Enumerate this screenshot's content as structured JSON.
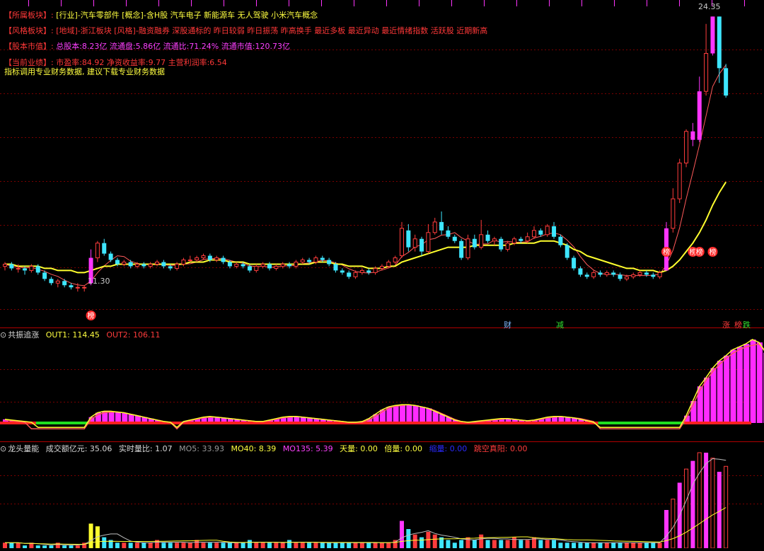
{
  "info": {
    "sector": {
      "key": "【所属板块】:",
      "value": "[行业]-汽车零部件 [概念]-含H股 汽车电子 新能源车 无人驾驶 小米汽车概念"
    },
    "style": {
      "key": "【风格板块】:",
      "value": "[地域]-浙江板块 [风格]-融资融券 深股通标的 昨日较弱 昨日振荡 昨高换手 最近多板 最近异动 最近情绪指数 活跃股 近期新高"
    },
    "capital": {
      "key": "【股本市值】:",
      "value": "总股本:8.23亿 流通盘:5.86亿 流通比:71.24% 流通市值:120.73亿"
    },
    "perf": {
      "key": "【当前业绩】:",
      "value": "市盈率:84.92 净资收益率:9.77 主营利润率:6.54"
    },
    "note": "指标调用专业财务数据, 建议下载专业财务数据"
  },
  "labels": {
    "price_high": "24.35",
    "price_low": "11.30",
    "limit_glyph": "榜",
    "cai": "财",
    "jian": "减",
    "zhang": "涨",
    "die": "跌"
  },
  "indicator1": {
    "name": "共振追涨",
    "out1": "OUT1: 114.45",
    "out2": "OUT2: 106.11"
  },
  "indicator2": {
    "name": "龙头量能",
    "amount": "成交额亿元: 35.06",
    "ratio": "实时量比: 1.07",
    "mo5": "MO5: 33.93",
    "mo40": "MO40: 8.39",
    "mo135": "MO135: 5.39",
    "tianliang": "天量: 0.00",
    "beiliang": "倍量: 0.00",
    "suoliang": "缩量: 0.00",
    "tiaokong": "跳空真阳: 0.00"
  },
  "colors": {
    "up": "#ff3c3c",
    "down": "#3ee6ff",
    "limit": "#ff35ff",
    "ma_yellow": "#ffff2e",
    "ma_red": "#ff5a5a",
    "grid": "#7a0000",
    "green": "#1fe01f",
    "osc": "#ff2bff"
  },
  "chart_data": [
    {
      "type": "candlestick",
      "title": "",
      "price_high": 24.35,
      "price_low": 11.3,
      "ylim": [
        10.3,
        25.0
      ],
      "candles": [
        [
          12.5,
          12.6,
          12.7,
          12.3
        ],
        [
          12.6,
          12.4,
          12.7,
          12.3
        ],
        [
          12.4,
          12.4,
          12.6,
          12.2
        ],
        [
          12.4,
          12.3,
          12.5,
          12.1
        ],
        [
          12.3,
          12.5,
          12.6,
          12.2
        ],
        [
          12.5,
          12.2,
          12.6,
          12.1
        ],
        [
          12.2,
          11.9,
          12.3,
          11.8
        ],
        [
          11.9,
          11.7,
          12.0,
          11.6
        ],
        [
          11.7,
          11.8,
          11.9,
          11.5
        ],
        [
          11.8,
          11.6,
          11.9,
          11.5
        ],
        [
          11.6,
          11.5,
          11.7,
          11.4
        ],
        [
          11.5,
          11.5,
          11.7,
          11.3
        ],
        [
          11.5,
          11.5,
          11.6,
          11.3
        ],
        [
          11.7,
          12.9,
          13.3,
          11.6
        ],
        [
          12.9,
          13.6,
          13.7,
          12.7
        ],
        [
          13.6,
          13.1,
          13.8,
          13.0
        ],
        [
          13.1,
          12.8,
          13.2,
          12.7
        ],
        [
          12.8,
          12.6,
          12.9,
          12.5
        ],
        [
          12.6,
          12.7,
          12.8,
          12.5
        ],
        [
          12.7,
          12.5,
          12.8,
          12.4
        ],
        [
          12.5,
          12.6,
          12.7,
          12.4
        ],
        [
          12.6,
          12.5,
          12.7,
          12.4
        ],
        [
          12.5,
          12.6,
          12.7,
          12.4
        ],
        [
          12.6,
          12.7,
          12.8,
          12.5
        ],
        [
          12.7,
          12.5,
          12.8,
          12.4
        ],
        [
          12.5,
          12.4,
          12.6,
          12.3
        ],
        [
          12.4,
          12.6,
          12.7,
          12.3
        ],
        [
          12.6,
          12.8,
          12.9,
          12.5
        ],
        [
          12.8,
          12.8,
          13.0,
          12.7
        ],
        [
          12.8,
          12.9,
          13.0,
          12.7
        ],
        [
          12.9,
          13.0,
          13.1,
          12.8
        ],
        [
          13.0,
          12.8,
          13.1,
          12.7
        ],
        [
          12.8,
          12.9,
          13.0,
          12.7
        ],
        [
          12.9,
          12.7,
          13.0,
          12.6
        ],
        [
          12.7,
          12.5,
          12.8,
          12.4
        ],
        [
          12.5,
          12.6,
          12.7,
          12.4
        ],
        [
          12.6,
          12.5,
          12.7,
          12.4
        ],
        [
          12.5,
          12.3,
          12.6,
          12.2
        ],
        [
          12.3,
          12.5,
          12.6,
          12.2
        ],
        [
          12.5,
          12.6,
          12.7,
          12.4
        ],
        [
          12.6,
          12.4,
          12.7,
          12.3
        ],
        [
          12.4,
          12.5,
          12.6,
          12.3
        ],
        [
          12.5,
          12.6,
          12.7,
          12.4
        ],
        [
          12.6,
          12.5,
          12.7,
          12.4
        ],
        [
          12.5,
          12.7,
          12.8,
          12.4
        ],
        [
          12.7,
          12.8,
          12.9,
          12.6
        ],
        [
          12.8,
          12.7,
          12.9,
          12.6
        ],
        [
          12.7,
          12.9,
          13.0,
          12.6
        ],
        [
          12.9,
          12.8,
          13.0,
          12.7
        ],
        [
          12.8,
          12.6,
          12.9,
          12.5
        ],
        [
          12.6,
          12.3,
          12.7,
          12.2
        ],
        [
          12.3,
          12.2,
          12.4,
          12.1
        ],
        [
          12.2,
          12.0,
          12.3,
          11.9
        ],
        [
          12.0,
          12.2,
          12.3,
          11.9
        ],
        [
          12.2,
          12.3,
          12.4,
          12.1
        ],
        [
          12.3,
          12.2,
          12.4,
          12.1
        ],
        [
          12.2,
          12.4,
          12.5,
          12.1
        ],
        [
          12.4,
          12.5,
          12.6,
          12.3
        ],
        [
          12.5,
          12.7,
          12.8,
          12.4
        ],
        [
          12.7,
          12.9,
          13.0,
          12.6
        ],
        [
          13.0,
          14.3,
          14.6,
          12.9
        ],
        [
          14.2,
          13.4,
          14.5,
          13.2
        ],
        [
          13.4,
          13.8,
          14.0,
          13.2
        ],
        [
          13.8,
          13.2,
          13.9,
          13.0
        ],
        [
          13.2,
          14.1,
          14.5,
          13.1
        ],
        [
          14.1,
          14.6,
          14.8,
          14.0
        ],
        [
          14.6,
          14.2,
          15.1,
          14.0
        ],
        [
          14.2,
          13.9,
          14.4,
          13.8
        ],
        [
          13.9,
          13.7,
          14.0,
          13.6
        ],
        [
          13.7,
          12.9,
          13.8,
          12.8
        ],
        [
          12.9,
          13.8,
          14.0,
          12.8
        ],
        [
          13.8,
          13.4,
          14.0,
          13.3
        ],
        [
          13.4,
          14.0,
          14.7,
          13.3
        ],
        [
          14.0,
          13.7,
          14.2,
          13.6
        ],
        [
          13.7,
          13.8,
          13.9,
          13.5
        ],
        [
          13.8,
          13.3,
          13.9,
          13.2
        ],
        [
          13.3,
          13.6,
          13.7,
          13.2
        ],
        [
          13.6,
          13.8,
          13.9,
          13.5
        ],
        [
          13.8,
          13.7,
          13.9,
          13.6
        ],
        [
          13.7,
          13.9,
          14.1,
          13.6
        ],
        [
          13.9,
          14.2,
          14.4,
          13.8
        ],
        [
          14.2,
          14.0,
          14.3,
          13.9
        ],
        [
          14.0,
          14.4,
          14.5,
          13.9
        ],
        [
          14.4,
          13.9,
          14.6,
          13.8
        ],
        [
          13.9,
          13.5,
          14.0,
          13.4
        ],
        [
          13.5,
          12.9,
          13.6,
          12.8
        ],
        [
          12.9,
          12.4,
          13.0,
          12.3
        ],
        [
          12.4,
          12.1,
          12.5,
          12.0
        ],
        [
          12.1,
          12.0,
          12.2,
          11.9
        ],
        [
          12.0,
          12.2,
          12.3,
          11.9
        ],
        [
          12.2,
          12.1,
          12.3,
          12.0
        ],
        [
          12.1,
          12.2,
          12.3,
          12.0
        ],
        [
          12.2,
          12.1,
          12.3,
          12.0
        ],
        [
          12.1,
          11.9,
          12.2,
          11.8
        ],
        [
          11.9,
          12.0,
          12.1,
          11.8
        ],
        [
          12.0,
          12.1,
          12.2,
          11.9
        ],
        [
          12.1,
          12.2,
          12.3,
          12.0
        ],
        [
          12.2,
          12.1,
          12.3,
          12.0
        ],
        [
          12.1,
          12.0,
          12.2,
          11.9
        ],
        [
          12.0,
          12.2,
          12.3,
          11.9
        ],
        [
          12.3,
          14.3,
          14.6,
          12.3
        ],
        [
          14.3,
          15.7,
          16.2,
          14.1
        ],
        [
          15.7,
          17.4,
          17.6,
          15.5
        ],
        [
          17.4,
          18.9,
          19.0,
          17.2
        ],
        [
          18.9,
          18.5,
          19.3,
          18.2
        ],
        [
          18.5,
          20.8,
          21.5,
          18.4
        ],
        [
          20.8,
          22.6,
          24.0,
          20.6
        ],
        [
          22.6,
          24.35,
          24.35,
          22.5
        ],
        [
          24.35,
          21.9,
          24.35,
          21.2
        ],
        [
          21.9,
          20.6,
          22.1,
          20.5
        ]
      ],
      "limit_up_days": [
        13,
        100,
        104,
        105,
        107
      ],
      "ma_yellow": [
        12.6,
        12.6,
        12.5,
        12.5,
        12.5,
        12.5,
        12.4,
        12.4,
        12.3,
        12.3,
        12.3,
        12.2,
        12.2,
        12.3,
        12.4,
        12.5,
        12.5,
        12.6,
        12.6,
        12.6,
        12.6,
        12.6,
        12.6,
        12.6,
        12.6,
        12.6,
        12.6,
        12.6,
        12.7,
        12.7,
        12.7,
        12.8,
        12.8,
        12.8,
        12.7,
        12.7,
        12.7,
        12.6,
        12.6,
        12.6,
        12.6,
        12.6,
        12.6,
        12.6,
        12.6,
        12.6,
        12.6,
        12.7,
        12.7,
        12.7,
        12.6,
        12.6,
        12.5,
        12.5,
        12.5,
        12.4,
        12.4,
        12.4,
        12.5,
        12.5,
        12.7,
        12.8,
        12.9,
        13.0,
        13.1,
        13.2,
        13.3,
        13.4,
        13.4,
        13.4,
        13.4,
        13.5,
        13.5,
        13.5,
        13.5,
        13.5,
        13.5,
        13.6,
        13.6,
        13.6,
        13.6,
        13.7,
        13.7,
        13.7,
        13.6,
        13.5,
        13.3,
        13.2,
        13.0,
        12.9,
        12.8,
        12.7,
        12.6,
        12.5,
        12.4,
        12.4,
        12.3,
        12.3,
        12.3,
        12.2,
        12.3,
        12.5,
        12.8,
        13.2,
        13.6,
        14.1,
        14.7,
        15.4,
        16.0,
        16.5
      ]
    },
    {
      "type": "bar",
      "title": "共振追涨",
      "series": [
        {
          "name": "OUT1",
          "values": [
            5,
            4,
            3,
            2,
            1,
            0,
            0,
            0,
            0,
            0,
            0,
            0,
            0,
            8,
            14,
            16,
            16,
            15,
            14,
            12,
            10,
            8,
            6,
            4,
            2,
            1,
            0,
            2,
            4,
            6,
            8,
            9,
            8,
            7,
            6,
            5,
            4,
            3,
            2,
            2,
            4,
            6,
            8,
            9,
            9,
            8,
            7,
            6,
            5,
            4,
            3,
            2,
            1,
            1,
            2,
            6,
            12,
            18,
            22,
            24,
            25,
            25,
            24,
            22,
            20,
            16,
            12,
            8,
            4,
            2,
            1,
            2,
            3,
            4,
            5,
            6,
            6,
            5,
            4,
            3,
            4,
            6,
            8,
            9,
            9,
            8,
            7,
            5,
            3,
            1,
            0,
            0,
            0,
            0,
            0,
            0,
            0,
            0,
            0,
            0,
            0,
            0,
            0,
            10,
            30,
            50,
            62,
            75,
            85,
            92,
            100,
            104,
            108,
            114,
            110,
            96
          ]
        },
        {
          "name": "OUT2",
          "values": [
            4,
            3,
            2,
            1,
            0,
            0,
            0,
            0,
            0,
            0,
            0,
            0,
            0,
            5,
            11,
            14,
            15,
            15,
            14,
            12,
            10,
            8,
            6,
            4,
            2,
            1,
            0,
            1,
            3,
            5,
            7,
            8,
            8,
            7,
            6,
            5,
            4,
            3,
            2,
            2,
            3,
            5,
            7,
            8,
            9,
            8,
            7,
            6,
            5,
            4,
            3,
            2,
            1,
            1,
            1,
            4,
            9,
            15,
            20,
            23,
            24,
            25,
            24,
            22,
            20,
            17,
            13,
            9,
            5,
            2,
            1,
            1,
            2,
            3,
            4,
            5,
            6,
            5,
            4,
            3,
            3,
            5,
            7,
            8,
            9,
            8,
            7,
            6,
            4,
            2,
            0,
            0,
            0,
            0,
            0,
            0,
            0,
            0,
            0,
            0,
            0,
            0,
            0,
            6,
            24,
            44,
            58,
            70,
            80,
            88,
            95,
            100,
            104,
            106,
            108,
            98
          ]
        }
      ],
      "ylim": [
        -20,
        120
      ]
    },
    {
      "type": "bar",
      "title": "龙头量能",
      "series": [
        {
          "name": "成交额亿元",
          "values": [
            2,
            2,
            2,
            1,
            2,
            1,
            1,
            1,
            2,
            1,
            1,
            1,
            2,
            9,
            8,
            4,
            3,
            2,
            2,
            2,
            2,
            2,
            2,
            3,
            2,
            2,
            2,
            2,
            2,
            3,
            2,
            2,
            2,
            2,
            2,
            2,
            2,
            3,
            2,
            2,
            2,
            2,
            2,
            3,
            2,
            2,
            2,
            2,
            2,
            2,
            2,
            2,
            2,
            2,
            2,
            2,
            2,
            2,
            2,
            3,
            10,
            7,
            5,
            4,
            6,
            5,
            4,
            3,
            2,
            3,
            4,
            3,
            5,
            3,
            3,
            3,
            3,
            4,
            3,
            3,
            4,
            3,
            3,
            3,
            2,
            2,
            2,
            2,
            2,
            2,
            2,
            2,
            2,
            2,
            2,
            2,
            2,
            2,
            2,
            2,
            14,
            18,
            24,
            29,
            32,
            35,
            35,
            33,
            28,
            30
          ]
        }
      ],
      "ylim": [
        0,
        40
      ]
    }
  ]
}
